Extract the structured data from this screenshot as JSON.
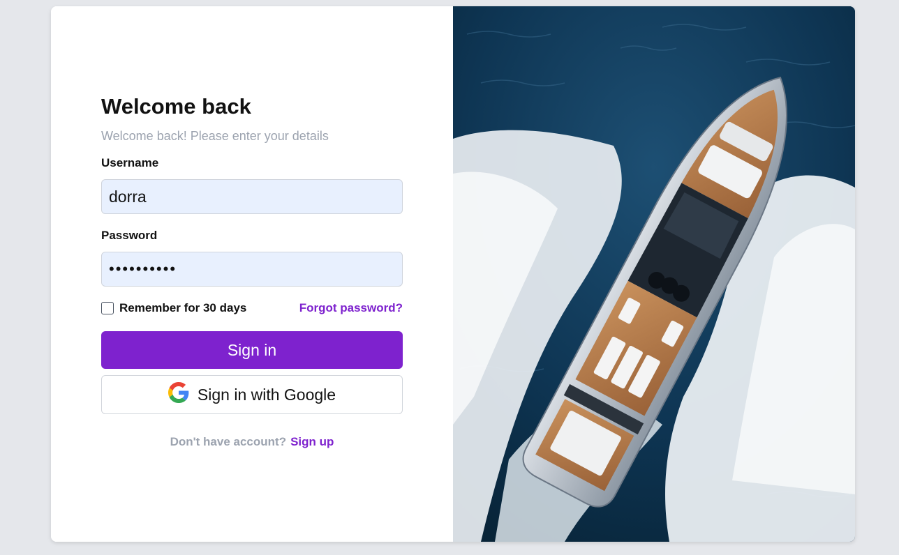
{
  "login": {
    "title": "Welcome back",
    "subtitle": "Welcome back! Please enter your details",
    "username_label": "Username",
    "username_value": "dorra",
    "password_label": "Password",
    "password_value": "••••••••••",
    "remember_label": "Remember for 30 days",
    "remember_checked": false,
    "forgot_label": "Forgot password?",
    "signin_label": "Sign in",
    "google_label": "Sign in with Google",
    "signup_prompt": "Don't have account?",
    "signup_label": "Sign up"
  },
  "hero_image": {
    "subject": "aerial view of a luxury motor yacht speeding across deep blue sea with white wake",
    "icon": "yacht-image"
  },
  "colors": {
    "accent": "#7e22ce",
    "input_bg": "#e8f0fe",
    "page_bg": "#e5e7eb",
    "muted_text": "#9ca3af"
  }
}
